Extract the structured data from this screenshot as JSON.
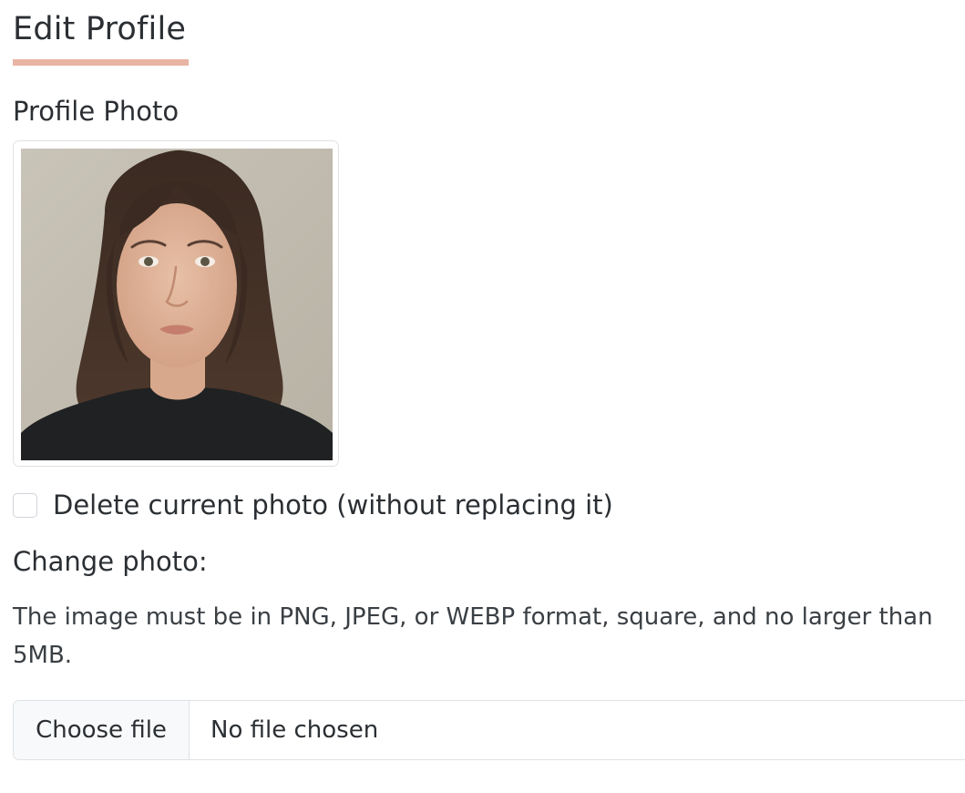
{
  "page": {
    "title": "Edit Profile",
    "accent_color": "#e8b4a3"
  },
  "profile_photo": {
    "label": "Profile Photo"
  },
  "delete_photo": {
    "checked": false,
    "label": "Delete current photo (without replacing it)"
  },
  "change_photo": {
    "label": "Change photo:",
    "help_text": "The image must be in PNG, JPEG, or WEBP format, square, and no larger than 5MB.",
    "button_label": "Choose file",
    "status_text": "No file chosen"
  }
}
